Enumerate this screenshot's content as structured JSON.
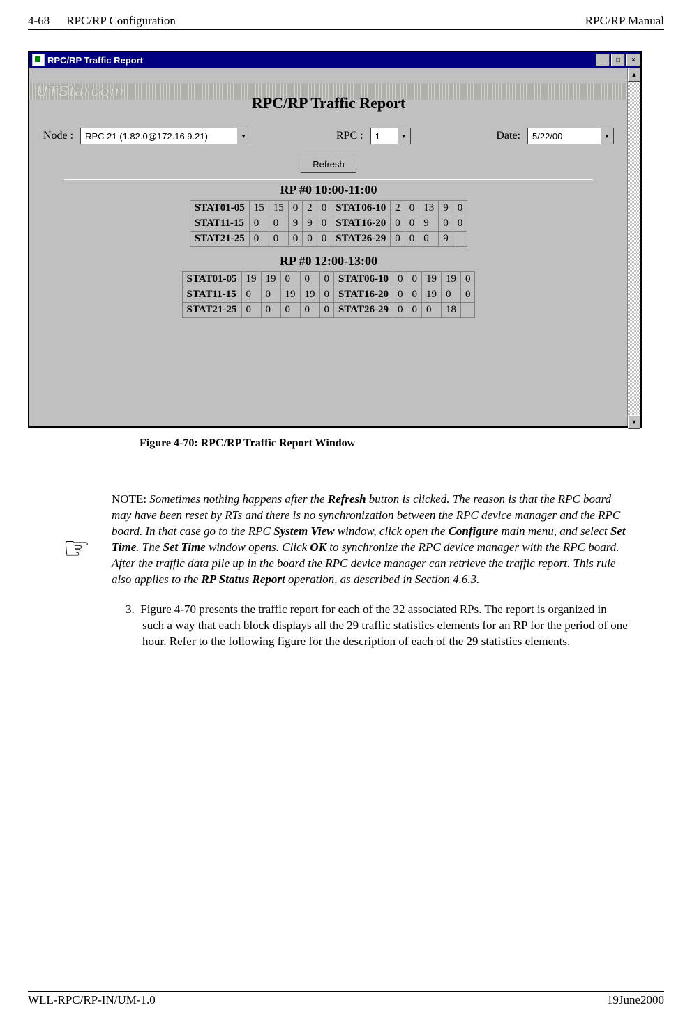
{
  "header": {
    "page_num": "4-68",
    "section": "RPC/RP Configuration",
    "manual": "RPC/RP Manual"
  },
  "footer": {
    "doc_id": "WLL-RPC/RP-IN/UM-1.0",
    "date": "19June2000"
  },
  "window": {
    "title": "RPC/RP Traffic Report",
    "watermark": "UTStarcom",
    "heading": "RPC/RP Traffic Report",
    "labels": {
      "node": "Node :",
      "rpc": "RPC :",
      "date": "Date:"
    },
    "inputs": {
      "node": "RPC 21 (1.82.0@172.16.9.21)",
      "rpc": "1",
      "date": "5/22/00"
    },
    "refresh": "Refresh",
    "blocks": [
      {
        "title": "RP #0 10:00-11:00",
        "rows": [
          {
            "l": "STAT01-05",
            "v": [
              "15",
              "15",
              "0",
              "2",
              "0"
            ],
            "r": "STAT06-10",
            "w": [
              "2",
              "0",
              "13",
              "9",
              "0"
            ]
          },
          {
            "l": "STAT11-15",
            "v": [
              "0",
              "0",
              "9",
              "9",
              "0"
            ],
            "r": "STAT16-20",
            "w": [
              "0",
              "0",
              "9",
              "0",
              "0"
            ]
          },
          {
            "l": "STAT21-25",
            "v": [
              "0",
              "0",
              "0",
              "0",
              "0"
            ],
            "r": "STAT26-29",
            "w": [
              "0",
              "0",
              "0",
              "9",
              ""
            ]
          }
        ]
      },
      {
        "title": "RP #0 12:00-13:00",
        "rows": [
          {
            "l": "STAT01-05",
            "v": [
              "19",
              "19",
              "0",
              "0",
              "0"
            ],
            "r": "STAT06-10",
            "w": [
              "0",
              "0",
              "19",
              "19",
              "0"
            ]
          },
          {
            "l": "STAT11-15",
            "v": [
              "0",
              "0",
              "19",
              "19",
              "0"
            ],
            "r": "STAT16-20",
            "w": [
              "0",
              "0",
              "19",
              "0",
              "0"
            ]
          },
          {
            "l": "STAT21-25",
            "v": [
              "0",
              "0",
              "0",
              "0",
              "0"
            ],
            "r": "STAT26-29",
            "w": [
              "0",
              "0",
              "0",
              "18",
              ""
            ]
          }
        ]
      }
    ]
  },
  "caption": "Figure 4-70: RPC/RP Traffic Report Window",
  "note": {
    "prefix": "NOTE: ",
    "t1": "Sometimes nothing happens after the ",
    "refresh": "Refresh",
    "t2": " button is clicked.  The reason is that the RPC board may have been reset by RTs and there is no synchronization between the RPC device manager and the RPC board.  In that case go to the RPC ",
    "sysview": "System View",
    "t3": " window, click open the ",
    "configure": "Configure",
    "t4": " main menu, and select ",
    "settime1": "Set Time",
    "t5": ".  The ",
    "settime2": "Set Time",
    "t6": " window opens.  Click ",
    "ok": "OK",
    "t7": " to synchronize the RPC device manager with the RPC board.  After the traffic data pile up in the board the RPC device manager can retrieve the traffic report.  This rule also applies to the ",
    "rpstatus": "RP Status Report",
    "t8": " operation, as described in Section 4.6.3."
  },
  "para3": {
    "num": "3.",
    "text": "Figure 4-70 presents the traffic report for each of the 32 associated RPs.  The report is organized in such a way that each block displays all the 29 traffic statistics elements for an RP for the period of one hour.  Refer to the following figure for the description of each of the 29 statistics elements."
  }
}
